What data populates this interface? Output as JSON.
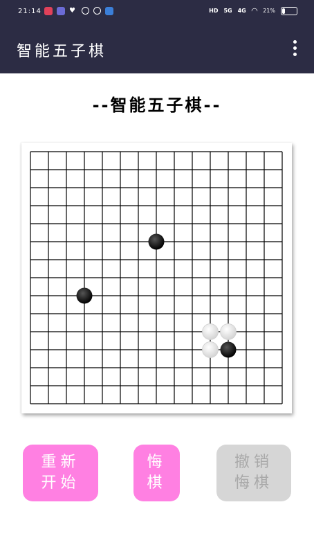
{
  "status_bar": {
    "time": "21:14",
    "network_labels": [
      "HD",
      "5G",
      "4G"
    ],
    "battery": "21%",
    "battery_level": 0.21
  },
  "app_bar": {
    "title": "智能五子棋",
    "menu_icon": "more-vert-icon"
  },
  "heading": "--智能五子棋--",
  "board": {
    "lines": 15,
    "stones": [
      {
        "col": 7,
        "row": 5,
        "color": "black"
      },
      {
        "col": 3,
        "row": 8,
        "color": "black"
      },
      {
        "col": 10,
        "row": 10,
        "color": "white"
      },
      {
        "col": 11,
        "row": 10,
        "color": "white"
      },
      {
        "col": 10,
        "row": 11,
        "color": "white"
      },
      {
        "col": 11,
        "row": 11,
        "color": "black"
      }
    ]
  },
  "buttons": {
    "restart": "重新\n开始",
    "undo": "悔\n棋",
    "cancel_undo": "撤销\n悔棋"
  },
  "colors": {
    "header": "#2c2c44",
    "accent": "#ff80e2",
    "disabled": "#d6d6d6"
  }
}
